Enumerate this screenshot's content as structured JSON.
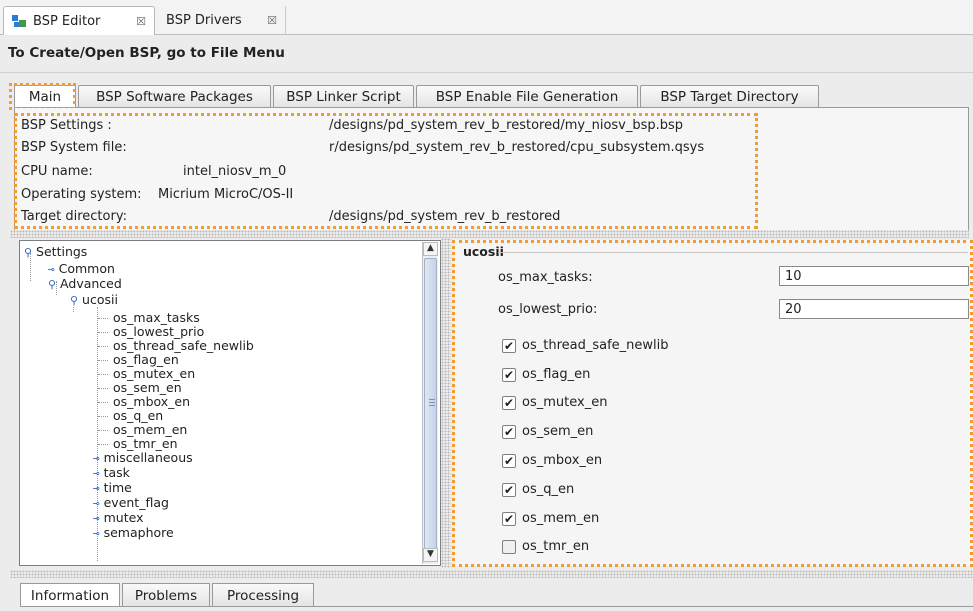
{
  "editor_tabs": [
    {
      "label": "BSP Editor",
      "close": "☒"
    },
    {
      "label": "BSP Drivers",
      "close": "☒"
    }
  ],
  "page_heading": "To Create/Open BSP, go to File Menu",
  "main_tabs": [
    "Main",
    "BSP Software Packages",
    "BSP Linker Script",
    "BSP Enable File Generation",
    "BSP Target Directory"
  ],
  "info": {
    "bsp_settings": {
      "label": "BSP Settings :",
      "value": "/designs/pd_system_rev_b_restored/my_niosv_bsp.bsp"
    },
    "bsp_system_file": {
      "label": "BSP System file:",
      "value": "r/designs/pd_system_rev_b_restored/cpu_subsystem.qsys"
    },
    "cpu_name": {
      "label": "CPU name:",
      "value": "intel_niosv_m_0"
    },
    "operating_system": {
      "label": "Operating system:",
      "value": "Micrium MicroC/OS-II"
    },
    "target_directory": {
      "label": "Target directory:",
      "value": "/designs/pd_system_rev_b_restored"
    }
  },
  "tree": {
    "settings": "Settings",
    "common": "Common",
    "advanced": "Advanced",
    "ucosii": "ucosii",
    "leaves": [
      "os_max_tasks",
      "os_lowest_prio",
      "os_thread_safe_newlib",
      "os_flag_en",
      "os_mutex_en",
      "os_sem_en",
      "os_mbox_en",
      "os_q_en",
      "os_mem_en",
      "os_tmr_en"
    ],
    "groups": [
      "miscellaneous",
      "task",
      "time",
      "event_flag",
      "mutex",
      "semaphore"
    ]
  },
  "settings_panel": {
    "title": "ucosii",
    "os_max_tasks": {
      "label": "os_max_tasks:",
      "value": "10"
    },
    "os_lowest_prio": {
      "label": "os_lowest_prio:",
      "value": "20"
    },
    "checkboxes": [
      {
        "label": "os_thread_safe_newlib",
        "checked": true,
        "mark": "✔"
      },
      {
        "label": "os_flag_en",
        "checked": true,
        "mark": "✔"
      },
      {
        "label": "os_mutex_en",
        "checked": true,
        "mark": "✔"
      },
      {
        "label": "os_sem_en",
        "checked": true,
        "mark": "✔"
      },
      {
        "label": "os_mbox_en",
        "checked": true,
        "mark": "✔"
      },
      {
        "label": "os_q_en",
        "checked": true,
        "mark": "✔"
      },
      {
        "label": "os_mem_en",
        "checked": true,
        "mark": "✔"
      },
      {
        "label": "os_tmr_en",
        "checked": false,
        "mark": ""
      }
    ]
  },
  "bottom_tabs": [
    "Information",
    "Problems",
    "Processing"
  ],
  "colors": {
    "highlight_dash": "#f39a33",
    "tree_key": "#2f68c4",
    "selection_bg": "#dce6f5"
  }
}
